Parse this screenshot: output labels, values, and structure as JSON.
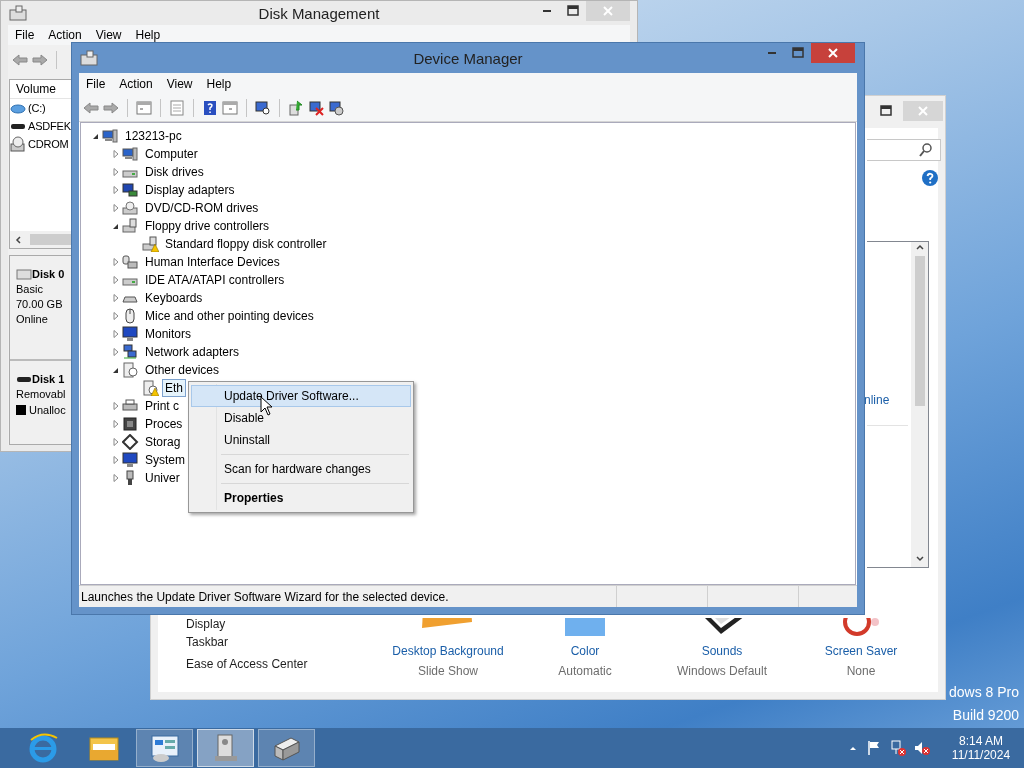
{
  "desktop": {
    "edition": "dows 8 Pro",
    "build": "Build 9200"
  },
  "disk_management": {
    "title": "Disk Management",
    "menu": [
      "File",
      "Action",
      "View",
      "Help"
    ],
    "volume_column": "Volume",
    "volumes": [
      {
        "name": "(C:)",
        "kind": "volume"
      },
      {
        "name": "ASDFEK",
        "kind": "drive"
      },
      {
        "name": "CDROM",
        "kind": "cdrom"
      }
    ],
    "disks": [
      {
        "name": "Disk 0",
        "kind": "basic",
        "lines": [
          "Basic",
          "70.00 GB",
          "Online"
        ]
      },
      {
        "name": "Disk 1",
        "kind": "removable",
        "lines": [
          "Removabl"
        ],
        "partition": "Unalloc"
      }
    ]
  },
  "control_panel": {
    "side_links": [
      "Display",
      "Taskbar",
      "Ease of Access Center"
    ],
    "list_text": "nline",
    "items": [
      {
        "kind": "background",
        "title": "Desktop Background",
        "value": "Slide Show"
      },
      {
        "kind": "color",
        "title": "Color",
        "value": "Automatic"
      },
      {
        "kind": "sounds",
        "title": "Sounds",
        "value": "Windows Default"
      },
      {
        "kind": "screensaver",
        "title": "Screen Saver",
        "value": "None"
      }
    ]
  },
  "device_manager": {
    "title": "Device Manager",
    "menu": [
      "File",
      "Action",
      "View",
      "Help"
    ],
    "tree": {
      "label": "123213-pc",
      "kind": "computer",
      "expanded": true,
      "selected": false,
      "children": [
        {
          "label": "Computer",
          "kind": "computer",
          "expanded": false,
          "selected": false
        },
        {
          "label": "Disk drives",
          "kind": "disk",
          "expanded": false,
          "selected": false
        },
        {
          "label": "Display adapters",
          "kind": "display",
          "expanded": false,
          "selected": false
        },
        {
          "label": "DVD/CD-ROM drives",
          "kind": "dvd",
          "expanded": false,
          "selected": false
        },
        {
          "label": "Floppy drive controllers",
          "kind": "floppy",
          "expanded": true,
          "selected": false,
          "children": [
            {
              "label": "Standard floppy disk controller",
              "kind": "floppy",
              "warning": true,
              "selected": false
            }
          ]
        },
        {
          "label": "Human Interface Devices",
          "kind": "hid",
          "expanded": false,
          "selected": false
        },
        {
          "label": "IDE ATA/ATAPI controllers",
          "kind": "disk",
          "expanded": false,
          "selected": false
        },
        {
          "label": "Keyboards",
          "kind": "keyboard",
          "expanded": false,
          "selected": false
        },
        {
          "label": "Mice and other pointing devices",
          "kind": "mouse",
          "expanded": false,
          "selected": false
        },
        {
          "label": "Monitors",
          "kind": "monitor",
          "expanded": false,
          "selected": false
        },
        {
          "label": "Network adapters",
          "kind": "network",
          "expanded": false,
          "selected": false
        },
        {
          "label": "Other devices",
          "kind": "other",
          "expanded": true,
          "selected": false,
          "children": [
            {
              "label": "Eth",
              "kind": "other",
              "warning": true,
              "selected": true
            }
          ]
        },
        {
          "label": "Print c",
          "kind": "printer",
          "expanded": false,
          "selected": false
        },
        {
          "label": "Proces",
          "kind": "processor",
          "expanded": false,
          "selected": false
        },
        {
          "label": "Storag",
          "kind": "storage",
          "expanded": false,
          "selected": false
        },
        {
          "label": "System",
          "kind": "monitor",
          "expanded": false,
          "selected": false
        },
        {
          "label": "Univer",
          "kind": "usb",
          "expanded": false,
          "selected": false
        }
      ]
    },
    "status_bar": "Launches the Update Driver Software Wizard for the selected device."
  },
  "context_menu": {
    "items": [
      {
        "kind": "item",
        "label": "Update Driver Software...",
        "selected": true,
        "default": false
      },
      {
        "kind": "item",
        "label": "Disable",
        "selected": false,
        "default": false
      },
      {
        "kind": "item",
        "label": "Uninstall",
        "selected": false,
        "default": false
      },
      {
        "kind": "separator"
      },
      {
        "kind": "item",
        "label": "Scan for hardware changes",
        "selected": false,
        "default": false
      },
      {
        "kind": "separator"
      },
      {
        "kind": "item",
        "label": "Properties",
        "selected": false,
        "default": true
      }
    ]
  },
  "taskbar": {
    "apps": [
      {
        "kind": "browser",
        "open": false,
        "selected": false
      },
      {
        "kind": "explorer",
        "open": false,
        "selected": false
      },
      {
        "kind": "control_panel",
        "open": true,
        "selected": false
      },
      {
        "kind": "device_manager",
        "open": true,
        "selected": true
      },
      {
        "kind": "disk_management",
        "open": true,
        "selected": false
      }
    ],
    "time": "8:14 AM",
    "date": "11/11/2024"
  }
}
